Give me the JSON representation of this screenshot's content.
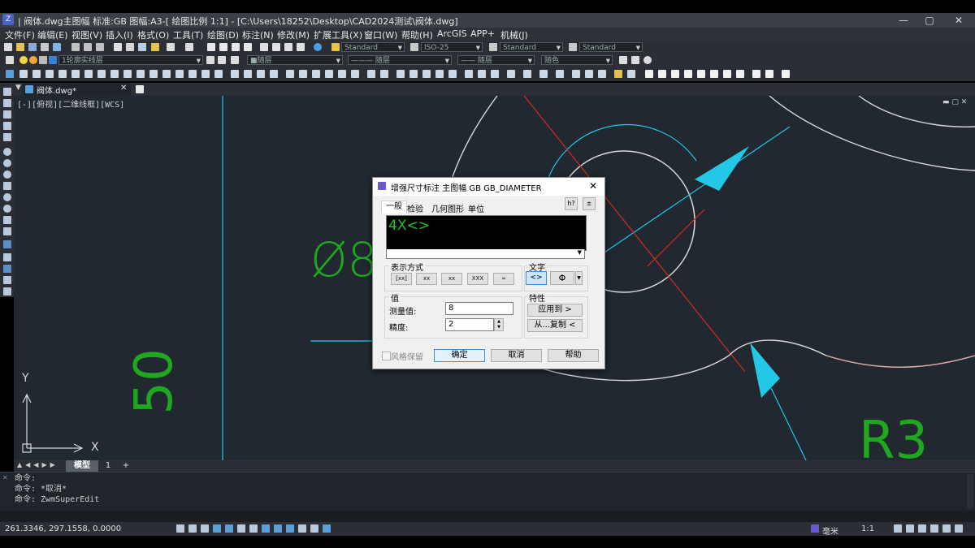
{
  "window": {
    "title": "| 阀体.dwg主图幅 标准:GB 图幅:A3-[ 绘图比例 1:1] - [C:\\Users\\18252\\Desktop\\CAD2024测试\\阀体.dwg]",
    "minimize": "—",
    "maximize": "▢",
    "close": "✕"
  },
  "menu": [
    "文件(F)",
    "编辑(E)",
    "视图(V)",
    "插入(I)",
    "格式(O)",
    "工具(T)",
    "绘图(D)",
    "标注(N)",
    "修改(M)",
    "扩展工具(X)",
    "窗口(W)",
    "帮助(H)",
    "ArcGIS",
    "APP+",
    "机械(J)"
  ],
  "toolbar": {
    "textstyle": "Standard",
    "dimstyle": "ISO-25",
    "tablestyle": "Standard",
    "mleaderstyle": "Standard",
    "layer": "1轮廓实线层",
    "color": "■随层",
    "linetype": "——— 随层",
    "lineweight": "—— 随层",
    "plotstyle": "随色"
  },
  "tabs": {
    "doc": "阀体.dwg*"
  },
  "viewport": {
    "label": "[-][俯视][二维线框][WCS]"
  },
  "drawing": {
    "dim_left": "Ø8",
    "dim_50": "50",
    "dim_r3": "R3",
    "axis_x": "X",
    "axis_y": "Y"
  },
  "dialog": {
    "title": "增强尺寸标注 主图幅 GB GB_DIAMETER",
    "tabs": [
      "一般",
      "检验",
      "几何图形",
      "单位"
    ],
    "help_btn": "h?",
    "text_value": "4X<>",
    "fmt_group": "表示方式",
    "fmt_buttons": [
      "[xx]",
      "xx",
      "xx",
      "XXX",
      "∞"
    ],
    "text_group": "文字",
    "text_btn1": "<>",
    "text_btn2": "Φ",
    "value_group": "值",
    "measured_label": "测量值:",
    "measured_value": "8",
    "precision_label": "精度:",
    "precision_value": "2",
    "prop_group": "特性",
    "apply_to": "应用到 >",
    "copy_from": "从...复制 <",
    "keep_style": "风格保留",
    "ok": "确定",
    "cancel": "取消",
    "help": "帮助"
  },
  "layout_tabs": [
    "模型",
    "1",
    "+"
  ],
  "command": {
    "lines": [
      "命令:",
      "命令: *取消*",
      "命令: ZwmSuperEdit"
    ]
  },
  "status": {
    "coords": "261.3346, 297.1558, 0.0000",
    "unit": "毫米",
    "scale": "1:1"
  },
  "colors": {
    "canvas": "#212830",
    "cyan": "#22c8e6",
    "green": "#1fa81f",
    "red": "#d42a2a",
    "dim": "#d8d8d8"
  }
}
